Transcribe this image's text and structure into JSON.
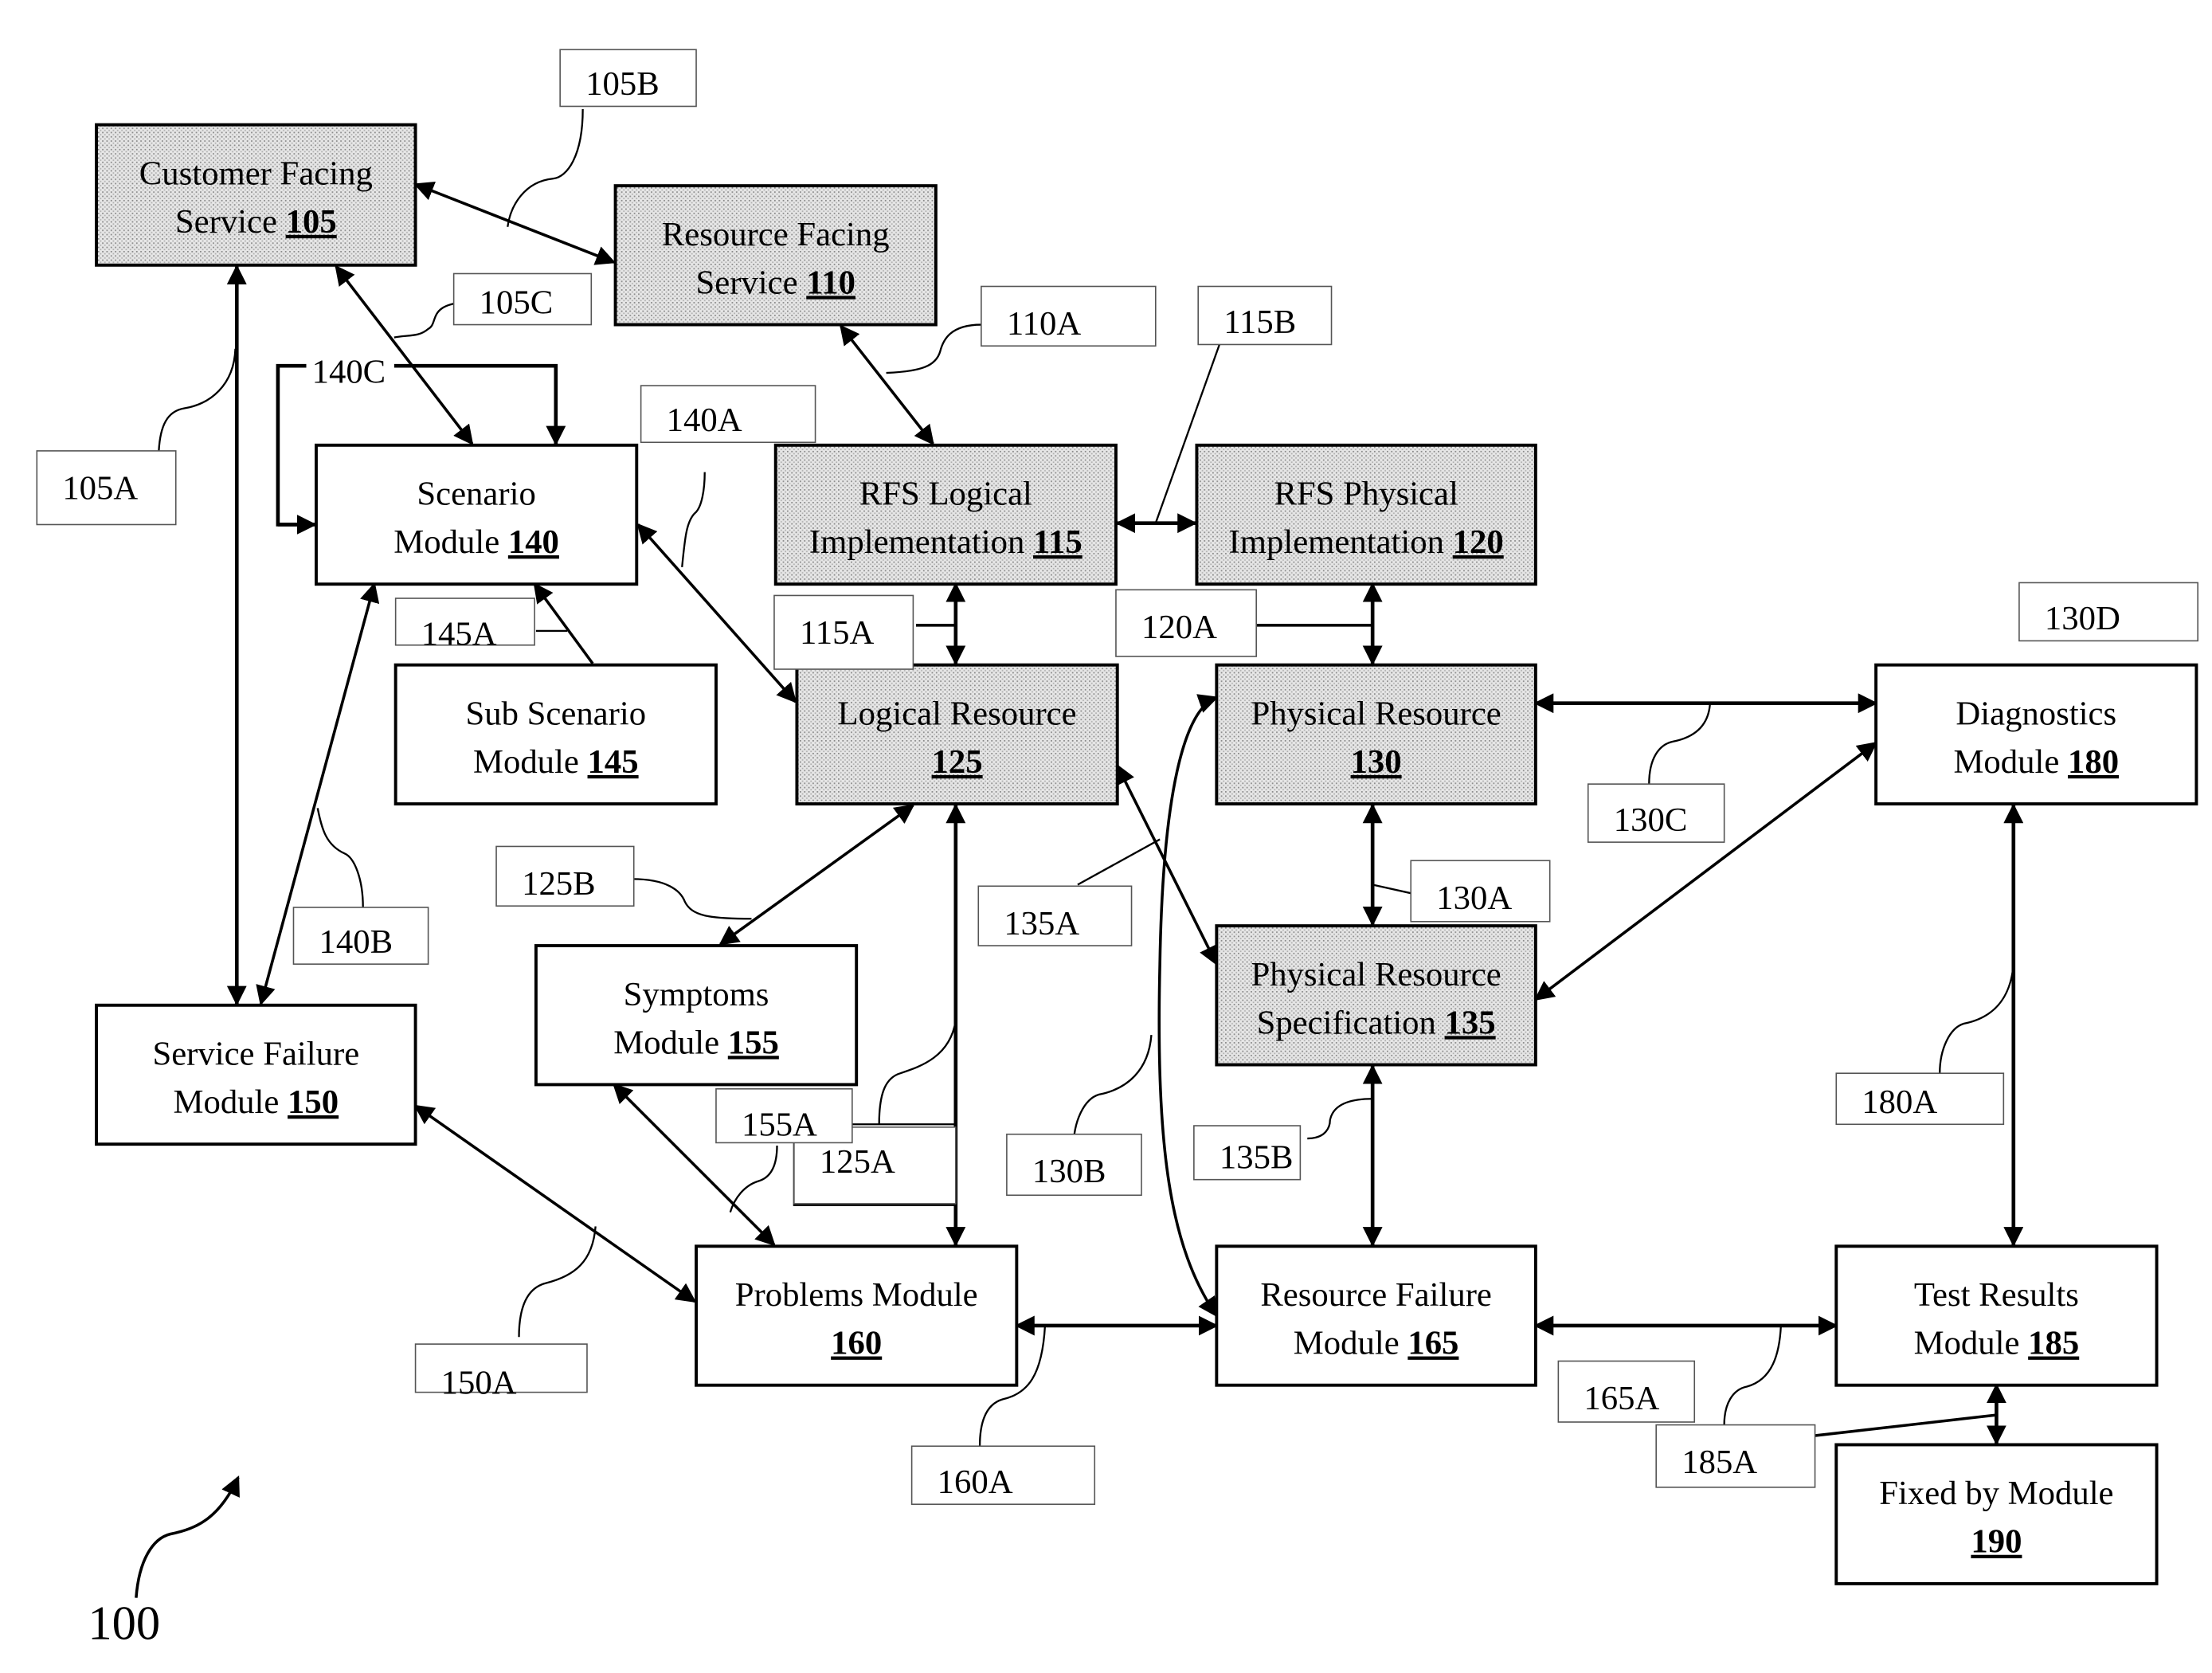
{
  "figure": {
    "number": "100"
  },
  "boxes": [
    {
      "id": "105",
      "line1": "Customer Facing",
      "line2": "Service ",
      "num": "105",
      "shaded": true
    },
    {
      "id": "110",
      "line1": "Resource Facing",
      "line2": "Service ",
      "num": "110",
      "shaded": true
    },
    {
      "id": "115",
      "line1": "RFS Logical",
      "line2": "Implementation ",
      "num": "115",
      "shaded": true
    },
    {
      "id": "120",
      "line1": "RFS Physical",
      "line2": "Implementation ",
      "num": "120",
      "shaded": true
    },
    {
      "id": "125",
      "line1": "Logical Resource",
      "line2": "",
      "num": "125",
      "shaded": true
    },
    {
      "id": "130",
      "line1": "Physical Resource",
      "line2": "",
      "num": "130",
      "shaded": true
    },
    {
      "id": "135",
      "line1": "Physical Resource",
      "line2": "Specification ",
      "num": "135",
      "shaded": true
    },
    {
      "id": "140",
      "line1": "Scenario",
      "line2": "Module ",
      "num": "140",
      "shaded": false
    },
    {
      "id": "145",
      "line1": "Sub Scenario",
      "line2": "Module ",
      "num": "145",
      "shaded": false
    },
    {
      "id": "150",
      "line1": "Service Failure",
      "line2": "Module ",
      "num": "150",
      "shaded": false
    },
    {
      "id": "155",
      "line1": "Symptoms",
      "line2": "Module ",
      "num": "155",
      "shaded": false
    },
    {
      "id": "160",
      "line1": "Problems Module",
      "line2": "",
      "num": "160",
      "shaded": false
    },
    {
      "id": "165",
      "line1": "Resource Failure",
      "line2": "Module ",
      "num": "165",
      "shaded": false
    },
    {
      "id": "180",
      "line1": "Diagnostics",
      "line2": "Module ",
      "num": "180",
      "shaded": false
    },
    {
      "id": "185",
      "line1": "Test Results",
      "line2": "Module ",
      "num": "185",
      "shaded": false
    },
    {
      "id": "190",
      "line1": "Fixed by Module",
      "line2": "",
      "num": "190",
      "shaded": false
    }
  ],
  "refs": [
    "105A",
    "105B",
    "105C",
    "110A",
    "115A",
    "115B",
    "120A",
    "125A",
    "125B",
    "130A",
    "130B",
    "130C",
    "130D",
    "135A",
    "135B",
    "140A",
    "140B",
    "140C",
    "145A",
    "150A",
    "155A",
    "160A",
    "165A",
    "180A",
    "185A"
  ]
}
